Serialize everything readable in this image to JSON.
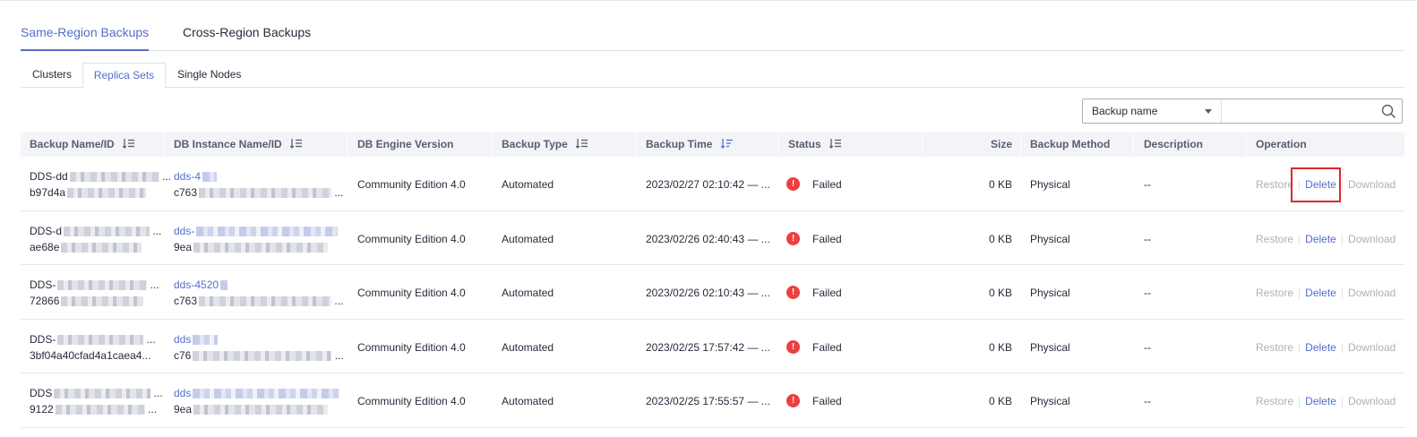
{
  "main_tabs": [
    "Same-Region Backups",
    "Cross-Region Backups"
  ],
  "sub_tabs": [
    "Clusters",
    "Replica Sets",
    "Single Nodes"
  ],
  "search": {
    "select_label": "Backup name",
    "value": ""
  },
  "columns": {
    "name": "Backup Name/ID",
    "instance": "DB Instance Name/ID",
    "engine": "DB Engine Version",
    "type": "Backup Type",
    "time": "Backup Time",
    "status": "Status",
    "size": "Size",
    "method": "Backup Method",
    "description": "Description",
    "operation": "Operation"
  },
  "rows": [
    {
      "name": "DDS-dd",
      "id": "b97d4a",
      "instance_name": "dds-4",
      "instance_id": "c763",
      "engine": "Community Edition 4.0",
      "type": "Automated",
      "time": "2023/02/27 02:10:42 — ...",
      "status": "Failed",
      "size": "0 KB",
      "method": "Physical",
      "description": "--"
    },
    {
      "name": "DDS-d",
      "id": "ae68e",
      "instance_name": "dds-",
      "instance_id": "9ea",
      "engine": "Community Edition 4.0",
      "type": "Automated",
      "time": "2023/02/26 02:40:43 — ...",
      "status": "Failed",
      "size": "0 KB",
      "method": "Physical",
      "description": "--"
    },
    {
      "name": "DDS-",
      "id": "72866",
      "instance_name": "dds-4520",
      "instance_id": "c763",
      "engine": "Community Edition 4.0",
      "type": "Automated",
      "time": "2023/02/26 02:10:43 — ...",
      "status": "Failed",
      "size": "0 KB",
      "method": "Physical",
      "description": "--"
    },
    {
      "name": "DDS-",
      "id": "3bf04a40cfad4a1caea4...",
      "instance_name": "dds",
      "instance_id": "c76",
      "engine": "Community Edition 4.0",
      "type": "Automated",
      "time": "2023/02/25 17:57:42 — ...",
      "status": "Failed",
      "size": "0 KB",
      "method": "Physical",
      "description": "--"
    },
    {
      "name": "DDS",
      "id": "9122",
      "instance_name": "dds",
      "instance_id": "9ea",
      "engine": "Community Edition 4.0",
      "type": "Automated",
      "time": "2023/02/25 17:55:57 — ...",
      "status": "Failed",
      "size": "0 KB",
      "method": "Physical",
      "description": "--"
    }
  ],
  "operations": {
    "restore": "Restore",
    "delete": "Delete",
    "download": "Download"
  },
  "colors": {
    "accent": "#526ecc",
    "danger": "#f03d3d",
    "highlight_box": "#e0262b",
    "disabled": "#adb0b8"
  }
}
